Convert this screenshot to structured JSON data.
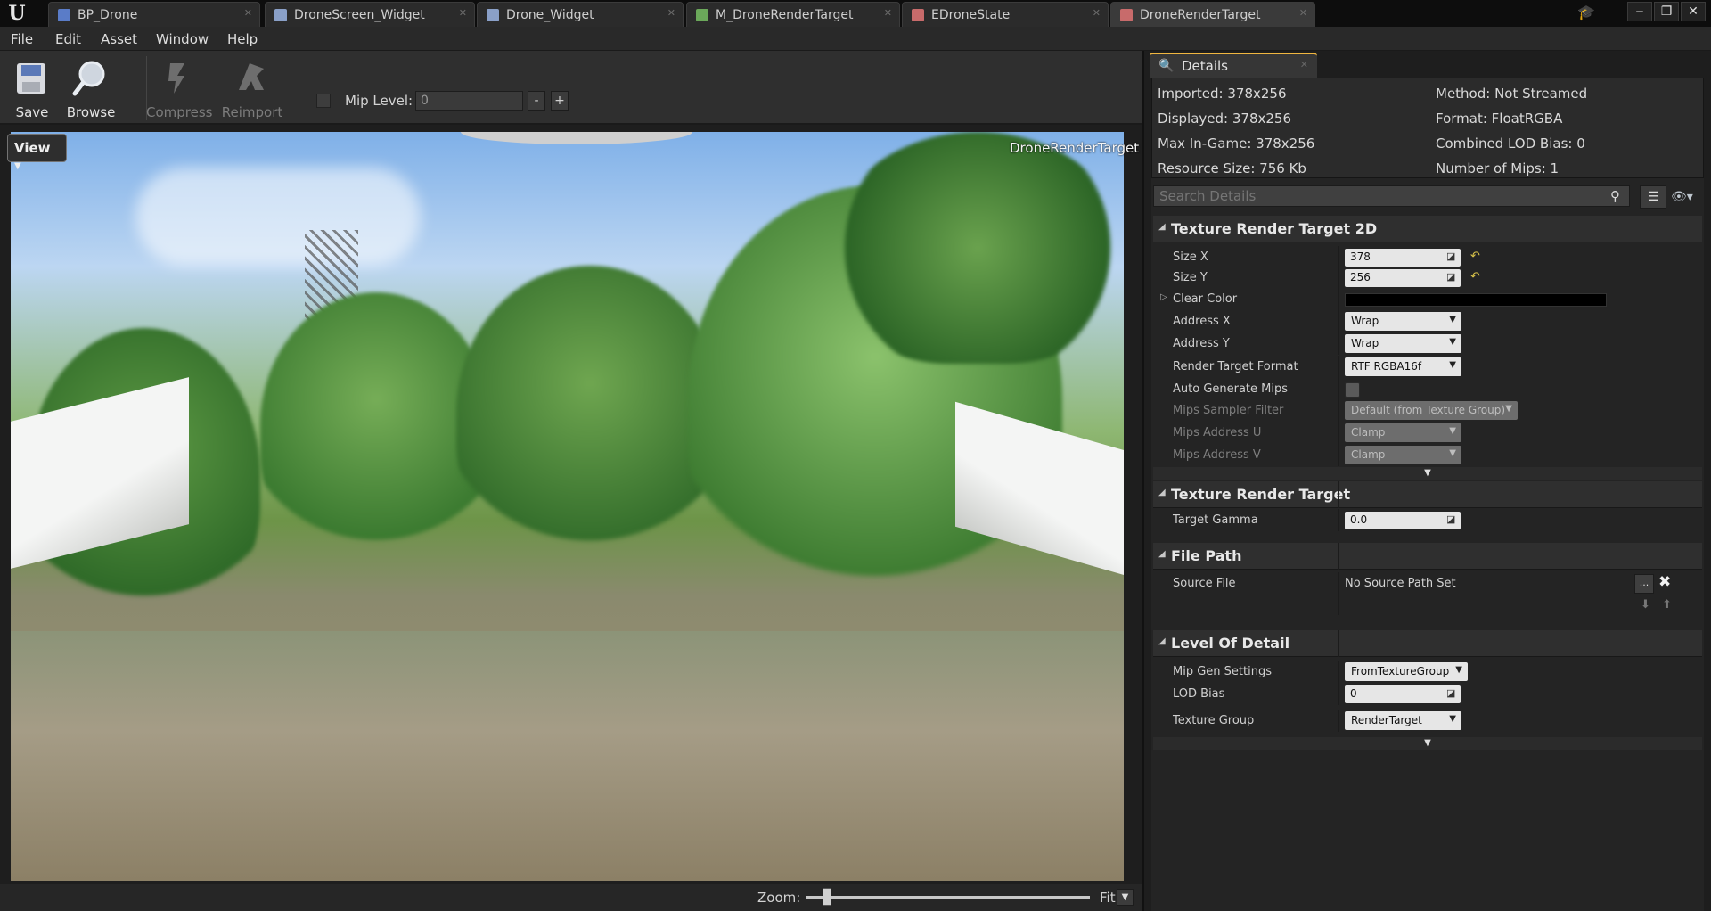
{
  "tabs": [
    {
      "label": "BP_Drone",
      "icon": "blueprint-icon",
      "color": "#5a7cc8"
    },
    {
      "label": "DroneScreen_Widget",
      "icon": "widget-icon",
      "color": "#8aa0c8"
    },
    {
      "label": "Drone_Widget",
      "icon": "widget-icon",
      "color": "#8aa0c8"
    },
    {
      "label": "M_DroneRenderTarget",
      "icon": "material-icon",
      "color": "#6ba85a"
    },
    {
      "label": "EDroneState",
      "icon": "enum-icon",
      "color": "#c86b6b"
    },
    {
      "label": "DroneRenderTarget",
      "icon": "render-target-icon",
      "color": "#c86b6b"
    }
  ],
  "window_controls": {
    "minimize": "‒",
    "restore": "❐",
    "close": "✕"
  },
  "menu": {
    "file": "File",
    "edit": "Edit",
    "asset": "Asset",
    "window": "Window",
    "help": "Help"
  },
  "toolbar": {
    "save": "Save",
    "browse": "Browse",
    "compress": "Compress",
    "reimport": "Reimport",
    "mip_level_label": "Mip Level:",
    "mip_level_value": "0",
    "minus": "-",
    "plus": "+"
  },
  "viewport": {
    "view_button": "View",
    "asset_label": "DroneRenderTarget"
  },
  "zoom": {
    "label": "Zoom:",
    "fit": "Fit"
  },
  "details": {
    "tab_label": "Details",
    "info": {
      "imported": "Imported: 378x256",
      "displayed": "Displayed: 378x256",
      "max_in_game": "Max In-Game: 378x256",
      "resource_size": "Resource Size: 756 Kb",
      "method": "Method: Not Streamed",
      "format": "Format: FloatRGBA",
      "combined_lod_bias": "Combined LOD Bias: 0",
      "number_of_mips": "Number of Mips: 1"
    },
    "search_placeholder": "Search Details",
    "sections": {
      "trt2d": "Texture Render Target 2D",
      "trt": "Texture Render Target",
      "file_path": "File Path",
      "lod": "Level Of Detail"
    },
    "props": {
      "size_x": {
        "label": "Size X",
        "value": "378"
      },
      "size_y": {
        "label": "Size Y",
        "value": "256"
      },
      "clear_color": {
        "label": "Clear Color",
        "value": "#000000"
      },
      "address_x": {
        "label": "Address X",
        "value": "Wrap"
      },
      "address_y": {
        "label": "Address Y",
        "value": "Wrap"
      },
      "render_target_format": {
        "label": "Render Target Format",
        "value": "RTF RGBA16f"
      },
      "auto_generate_mips": {
        "label": "Auto Generate Mips",
        "checked": false
      },
      "mips_sampler_filter": {
        "label": "Mips Sampler Filter",
        "value": "Default (from Texture Group)"
      },
      "mips_address_u": {
        "label": "Mips Address U",
        "value": "Clamp"
      },
      "mips_address_v": {
        "label": "Mips Address V",
        "value": "Clamp"
      },
      "target_gamma": {
        "label": "Target Gamma",
        "value": "0.0"
      },
      "source_file": {
        "label": "Source File",
        "value": "No Source Path Set"
      },
      "mip_gen_settings": {
        "label": "Mip Gen Settings",
        "value": "FromTextureGroup"
      },
      "lod_bias": {
        "label": "LOD Bias",
        "value": "0"
      },
      "texture_group": {
        "label": "Texture Group",
        "value": "RenderTarget"
      }
    }
  }
}
